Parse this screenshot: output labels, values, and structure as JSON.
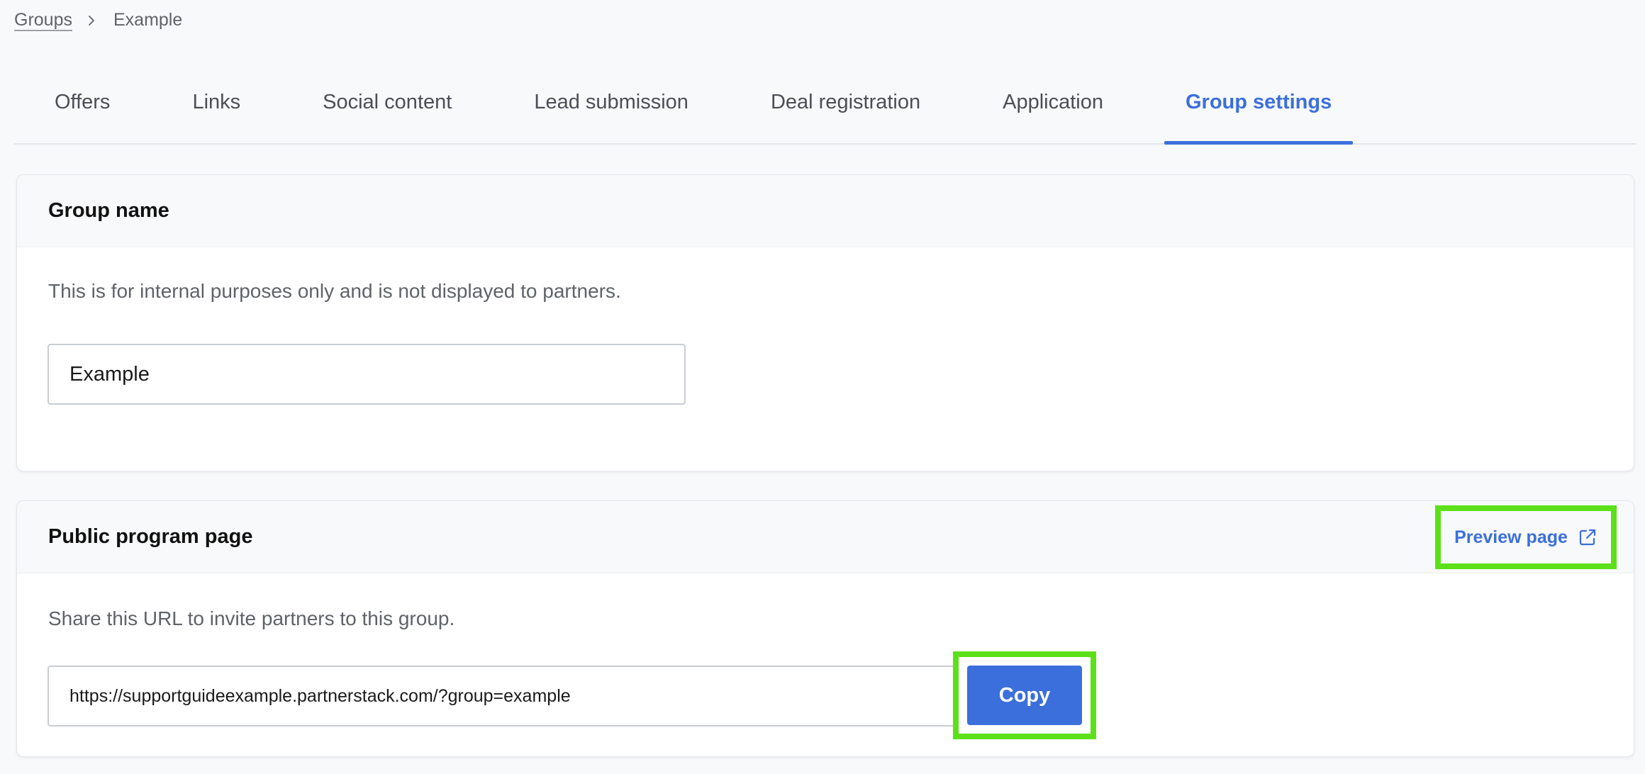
{
  "breadcrumb": {
    "parent": "Groups",
    "current": "Example"
  },
  "tabs": [
    {
      "label": "Offers",
      "active": false
    },
    {
      "label": "Links",
      "active": false
    },
    {
      "label": "Social content",
      "active": false
    },
    {
      "label": "Lead submission",
      "active": false
    },
    {
      "label": "Deal registration",
      "active": false
    },
    {
      "label": "Application",
      "active": false
    },
    {
      "label": "Group settings",
      "active": true
    }
  ],
  "group_name_card": {
    "title": "Group name",
    "description": "This is for internal purposes only and is not displayed to partners.",
    "input_value": "Example"
  },
  "public_page_card": {
    "title": "Public program page",
    "preview_label": "Preview page",
    "preview_icon": "external-link-icon",
    "description": "Share this URL to invite partners to this group.",
    "url_value": "https://supportguideexample.partnerstack.com/?group=example",
    "copy_label": "Copy"
  },
  "colors": {
    "accent": "#3b6fdb",
    "highlight": "#5ce019",
    "background": "#f8f9fb"
  }
}
